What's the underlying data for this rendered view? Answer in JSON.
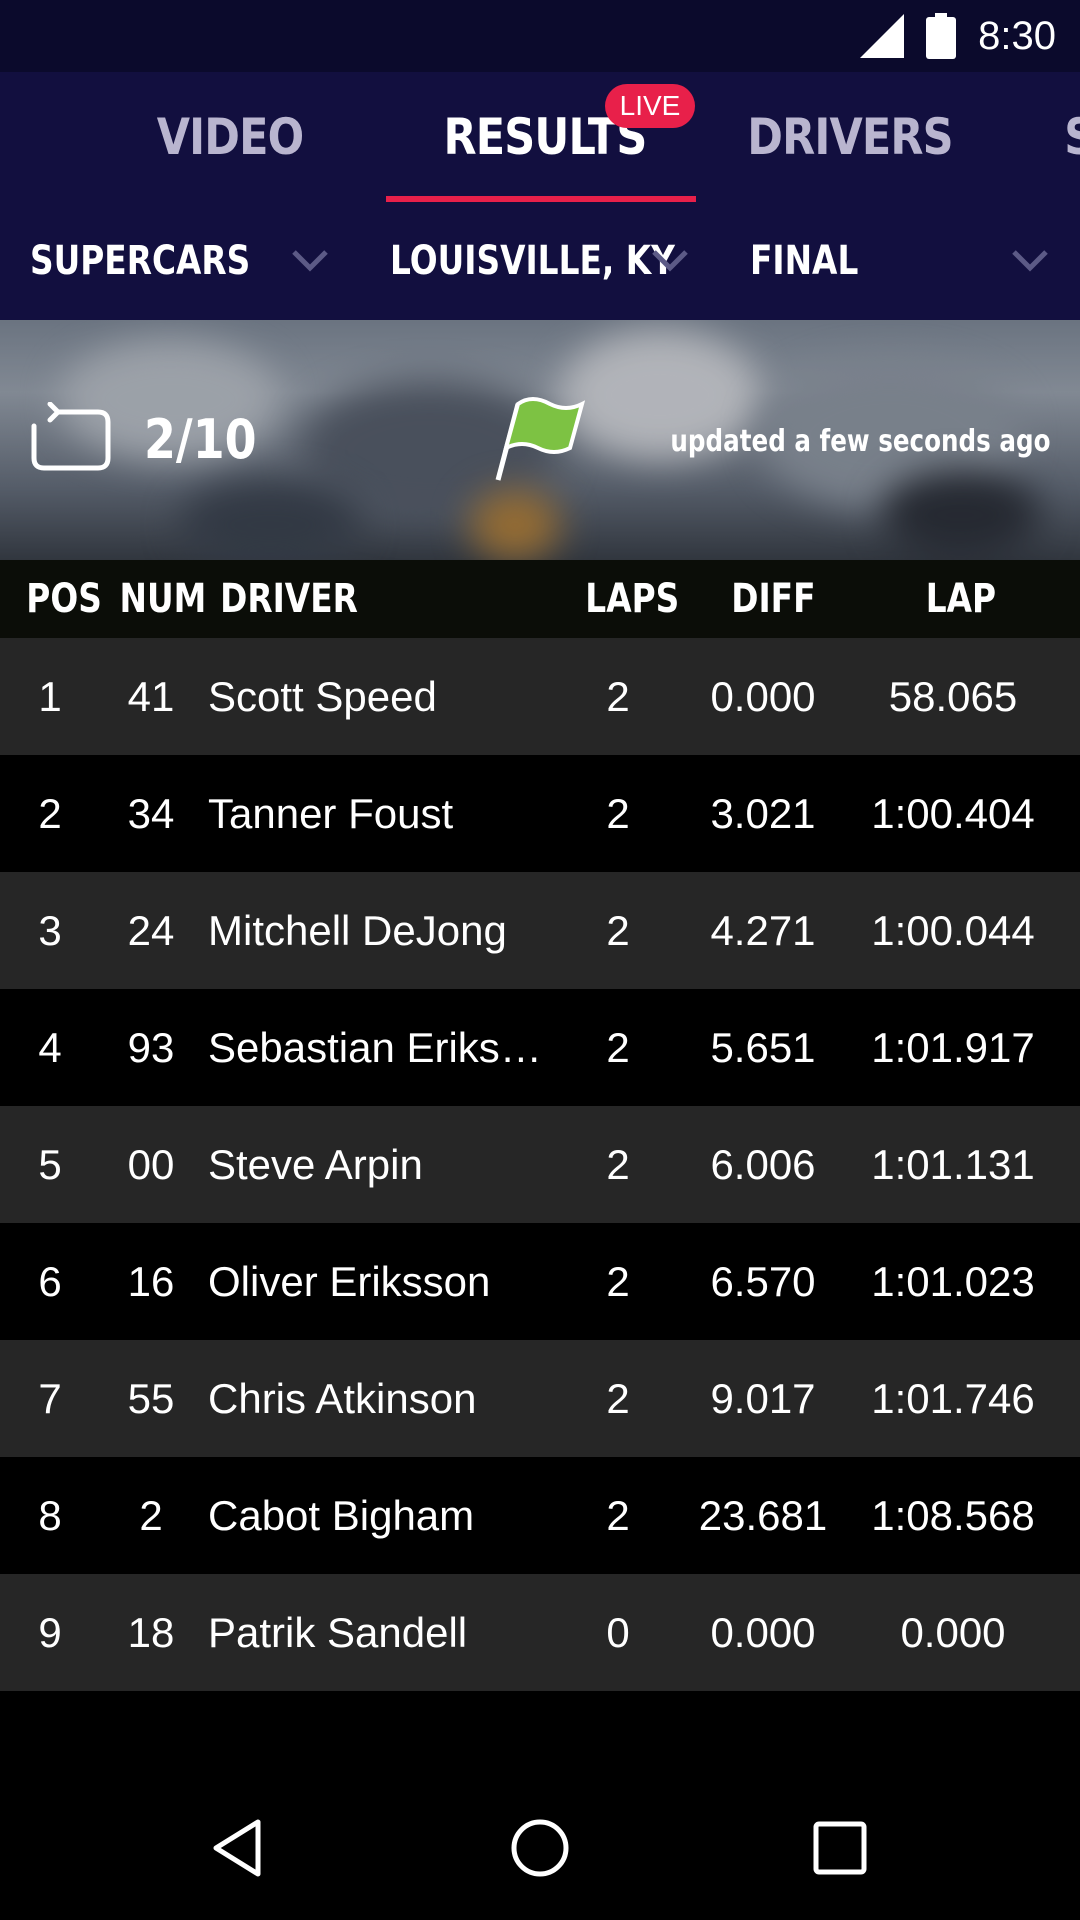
{
  "status_bar": {
    "time": "8:30",
    "icons": [
      "signal-icon",
      "battery-icon"
    ]
  },
  "tabs": {
    "items": [
      {
        "label": "VIDEO",
        "active": false
      },
      {
        "label": "RESULTS",
        "active": true
      },
      {
        "label": "DRIVERS",
        "active": false
      },
      {
        "label": "S",
        "active": false
      }
    ],
    "live_badge": "LIVE",
    "accent_color": "#e8204a"
  },
  "filters": {
    "series": "SUPERCARS",
    "location": "LOUISVILLE, KY",
    "session": "FINAL"
  },
  "race_status": {
    "lap_counter": "2/10",
    "flag": "green-flag-icon",
    "updated": "updated a few seconds ago"
  },
  "table": {
    "headers": {
      "pos": "POS",
      "num": "NUM",
      "driver": "DRIVER",
      "laps": "LAPS",
      "diff": "DIFF",
      "lap": "LAP"
    },
    "rows": [
      {
        "pos": "1",
        "num": "41",
        "driver": "Scott Speed",
        "laps": "2",
        "diff": "0.000",
        "lap": "58.065"
      },
      {
        "pos": "2",
        "num": "34",
        "driver": "Tanner Foust",
        "laps": "2",
        "diff": "3.021",
        "lap": "1:00.404"
      },
      {
        "pos": "3",
        "num": "24",
        "driver": "Mitchell DeJong",
        "laps": "2",
        "diff": "4.271",
        "lap": "1:00.044"
      },
      {
        "pos": "4",
        "num": "93",
        "driver": "Sebastian Erikss...",
        "laps": "2",
        "diff": "5.651",
        "lap": "1:01.917"
      },
      {
        "pos": "5",
        "num": "00",
        "driver": "Steve Arpin",
        "laps": "2",
        "diff": "6.006",
        "lap": "1:01.131"
      },
      {
        "pos": "6",
        "num": "16",
        "driver": "Oliver Eriksson",
        "laps": "2",
        "diff": "6.570",
        "lap": "1:01.023"
      },
      {
        "pos": "7",
        "num": "55",
        "driver": "Chris Atkinson",
        "laps": "2",
        "diff": "9.017",
        "lap": "1:01.746"
      },
      {
        "pos": "8",
        "num": "2",
        "driver": "Cabot Bigham",
        "laps": "2",
        "diff": "23.681",
        "lap": "1:08.568"
      },
      {
        "pos": "9",
        "num": "18",
        "driver": "Patrik Sandell",
        "laps": "0",
        "diff": "0.000",
        "lap": "0.000"
      }
    ]
  },
  "nav_bar": {
    "icons": [
      "back-icon",
      "home-icon",
      "recents-icon"
    ]
  }
}
